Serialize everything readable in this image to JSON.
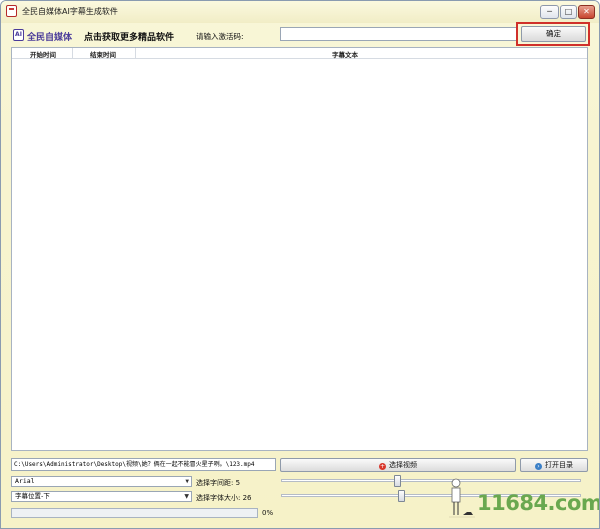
{
  "window": {
    "title": "全民自媒体AI字幕生成软件",
    "controls": {
      "minimize": "─",
      "maximize": "□",
      "close": "✕"
    }
  },
  "header": {
    "logo_mark": "AI",
    "logo_text": "全民自媒体",
    "promo_link": "点击获取更多精品软件",
    "code_label": "请输入激活码:",
    "code_value": "",
    "confirm_label": "确定"
  },
  "table": {
    "columns": [
      "开始时间",
      "结束时间",
      "字幕文本"
    ],
    "rows": []
  },
  "controls": {
    "file_path": "C:\\Users\\Administrator\\Desktop\\视频\\她？俩在一起不能冒火星子咧。\\123.mp4",
    "select_video_label": "选择视频",
    "open_dir_label": "打开目录",
    "font_select": "Arial",
    "position_select": "字幕位置-下",
    "spacing_label": "选择字间距: 5",
    "size_label": "选择字体大小: 26",
    "spacing_value": 5,
    "size_value": 26,
    "progress_percent": 0,
    "progress_text": "0%"
  },
  "watermark": {
    "text": "11684.com"
  },
  "colors": {
    "accent_red": "#d0302a",
    "logo_purple": "#4a3b9a",
    "watermark_green": "#6aa84f"
  }
}
